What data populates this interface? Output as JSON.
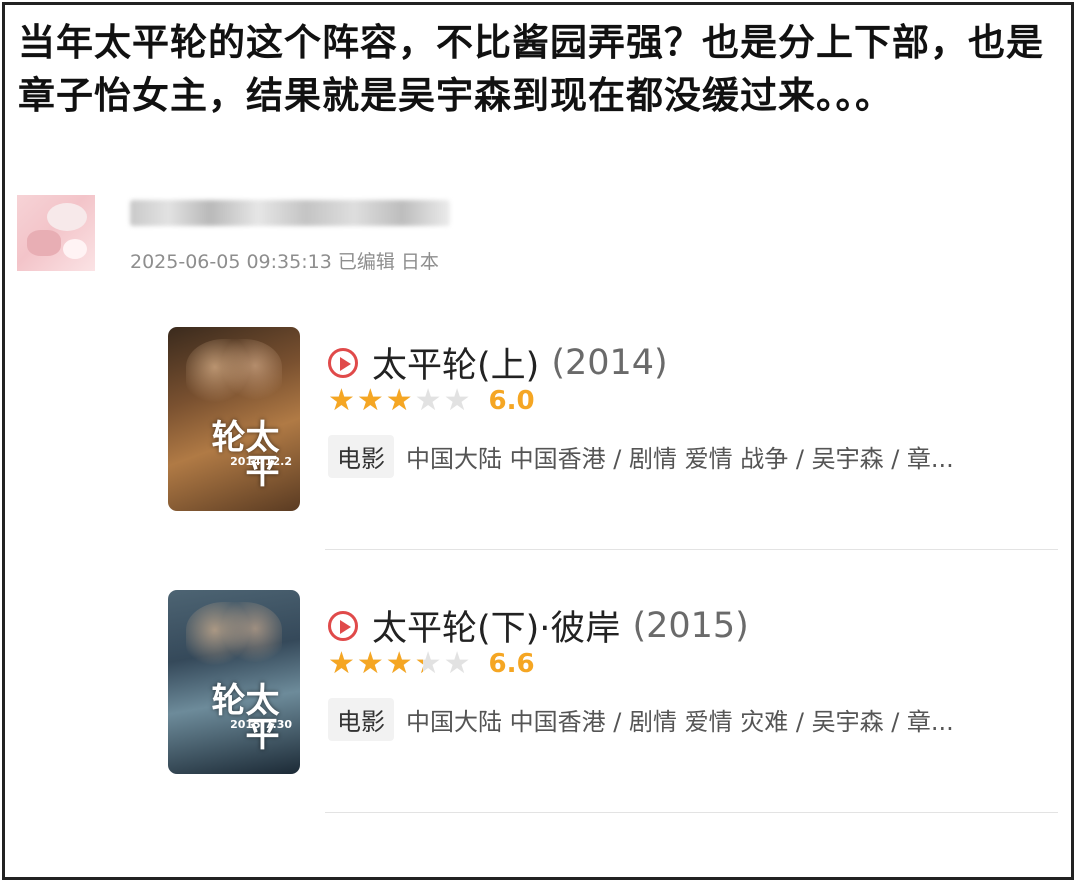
{
  "post": {
    "text": "当年太平轮的这个阵容，不比酱园弄强？也是分上下部，也是章子怡女主，结果就是吴宇森到现在都没缓过来。。。",
    "meta": "2025-06-05 09:35:13 已编辑 日本"
  },
  "movies": [
    {
      "title": "太平轮(上)",
      "year": "(2014)",
      "stars_fraction": 0.6,
      "score": "6.0",
      "tag": "电影",
      "desc": "中国大陆 中国香港 / 剧情 爱情 战争 / 吴宇森 / 章...",
      "poster_title": "太平轮",
      "poster_date": "2014.12.2"
    },
    {
      "title": "太平轮(下)·彼岸",
      "year": "(2015)",
      "stars_fraction": 0.66,
      "score": "6.6",
      "tag": "电影",
      "desc": "中国大陆 中国香港 / 剧情 爱情 灾难 / 吴宇森 / 章...",
      "poster_title": "太平轮",
      "poster_date": "2015.7.30"
    }
  ],
  "colors": {
    "accent_star": "#f5a623",
    "play_red": "#e04a4a"
  },
  "icons": [
    "play-icon",
    "star-icon"
  ]
}
